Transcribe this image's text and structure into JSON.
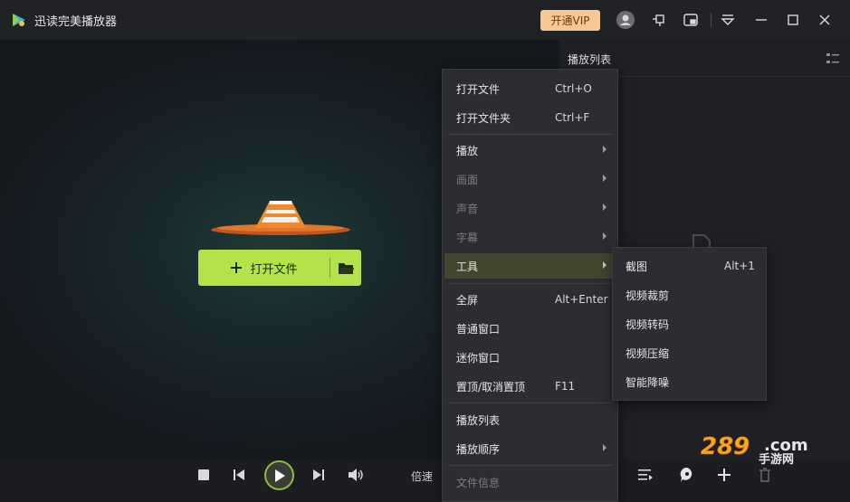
{
  "window": {
    "title": "迅读完美播放器",
    "vip_label": "开通VIP"
  },
  "colors": {
    "accent": "#b3e24a",
    "vip": "#f7c893",
    "menu_bg": "#2b2d31",
    "active_item": "#44472e"
  },
  "video": {
    "open_file_label": "打开文件"
  },
  "playlist": {
    "title": "播放列表"
  },
  "controls": {
    "speed_label": "倍速"
  },
  "menu": {
    "open_file": {
      "label": "打开文件",
      "shortcut": "Ctrl+O"
    },
    "open_folder": {
      "label": "打开文件夹",
      "shortcut": "Ctrl+F"
    },
    "play": {
      "label": "播放"
    },
    "picture": {
      "label": "画面"
    },
    "audio": {
      "label": "声音"
    },
    "subtitle": {
      "label": "字幕"
    },
    "tools": {
      "label": "工具"
    },
    "fullscreen": {
      "label": "全屏",
      "shortcut": "Alt+Enter"
    },
    "normal_window": {
      "label": "普通窗口"
    },
    "mini_window": {
      "label": "迷你窗口"
    },
    "pin_top": {
      "label": "置顶/取消置顶",
      "shortcut": "F11"
    },
    "playlist": {
      "label": "播放列表"
    },
    "play_order": {
      "label": "播放顺序"
    },
    "file_info": {
      "label": "文件信息"
    }
  },
  "tools_submenu": {
    "screenshot": {
      "label": "截图",
      "shortcut": "Alt+1"
    },
    "video_cut": {
      "label": "视频裁剪"
    },
    "video_convert": {
      "label": "视频转码"
    },
    "video_compress": {
      "label": "视频压缩"
    },
    "denoise": {
      "label": "智能降噪"
    }
  },
  "watermark": {
    "text": "289.com",
    "sub": "手游网"
  }
}
